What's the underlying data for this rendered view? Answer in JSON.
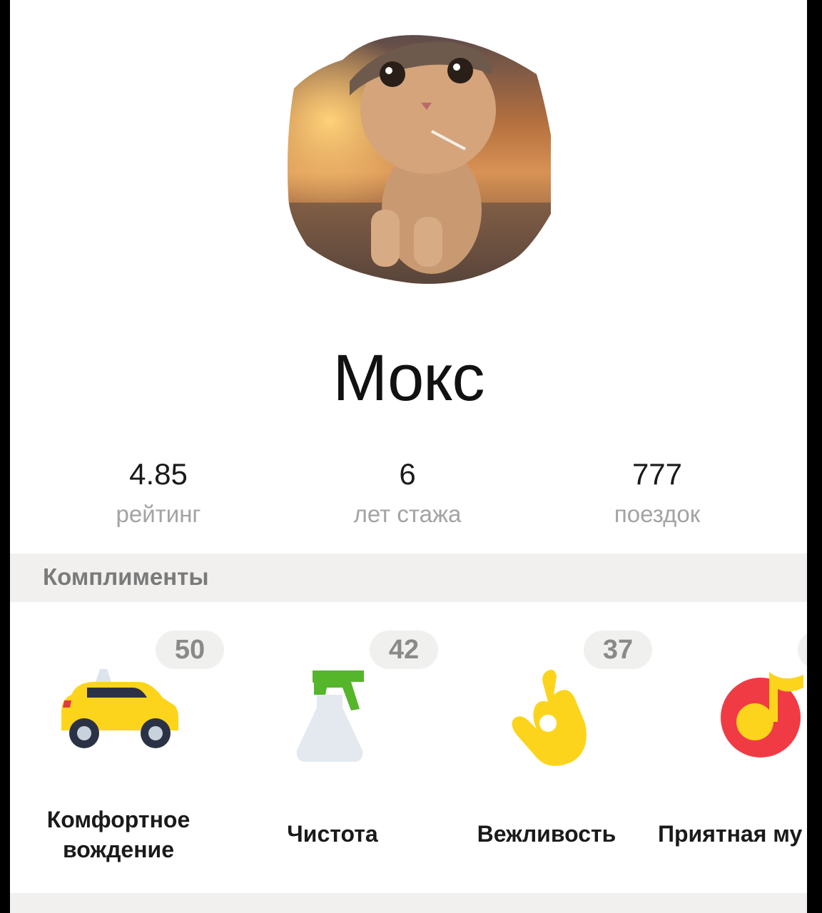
{
  "profile": {
    "name": "Мокс"
  },
  "stats": [
    {
      "value": "4.85",
      "label": "рейтинг"
    },
    {
      "value": "6",
      "label": "лет стажа"
    },
    {
      "value": "777",
      "label": "поездок"
    }
  ],
  "compliments_section": {
    "title": "Комплименты",
    "items": [
      {
        "count": "50",
        "label": "Комфортное\nвождение",
        "icon": "taxi-car-icon"
      },
      {
        "count": "42",
        "label": "Чистота",
        "icon": "spray-bottle-icon"
      },
      {
        "count": "37",
        "label": "Вежливость",
        "icon": "ok-hand-icon"
      },
      {
        "count": "",
        "label": "Приятная му",
        "icon": "music-note-icon"
      }
    ]
  },
  "colors": {
    "taxi_yellow": "#fcd41c",
    "music_red": "#f03b45",
    "spray_green": "#55b52b",
    "badge_bg": "#f0f0ee",
    "section_bg": "#f1f0ee"
  }
}
